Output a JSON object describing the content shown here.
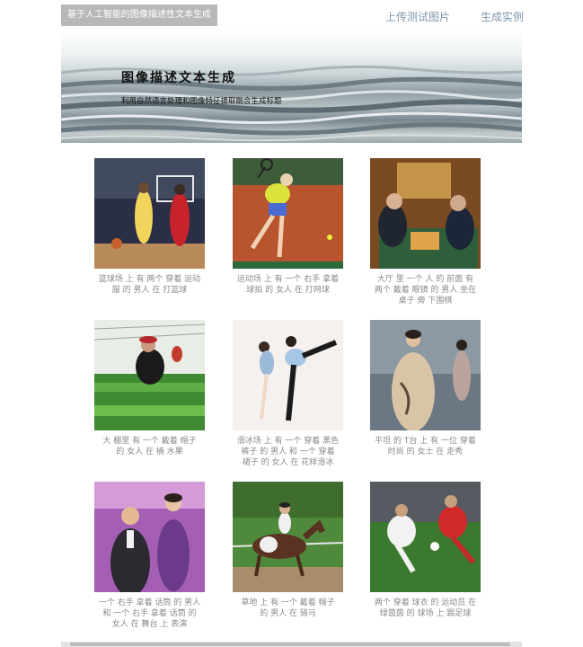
{
  "header": {
    "site_title": "基于人工智能的图像描述性文本生成",
    "nav": [
      "上传测试图片",
      "生成实例"
    ]
  },
  "banner": {
    "title": "图像描述文本生成",
    "subtitle": "利用自然语言处理和图像特征提取融合生成标题"
  },
  "gallery": [
    {
      "caption": "篮球场 上 有 两个 穿着 运动服 的 男人 在 打篮球"
    },
    {
      "caption": "运动场 上 有 一个 右手 拿着 球拍 的 女人 在 打网球"
    },
    {
      "caption": "大厅 里 一个 人 的 前面 有 两个 戴着 眼镜 的 男人 坐在 桌子 旁 下围棋"
    },
    {
      "caption": "大 棚里 有 一个 戴着 帽子 的 女人 在 摘 水果"
    },
    {
      "caption": "滑冰场 上 有 一个 穿着 黑色 裤子 的 男人 和 一个 穿着 裙子 的 女人 在 花样滑冰"
    },
    {
      "caption": "平坦 的 T台 上 有 一位 穿着 时尚 的 女士 在 走秀"
    },
    {
      "caption": "一个 右手 拿着 话筒 的 男人 和 一个 右手 拿着 话筒 的 女人 在 舞台 上 表演"
    },
    {
      "caption": "草地 上 有 一个 戴着 帽子 的 男人 在 骑马"
    },
    {
      "caption": "两个 穿着 球衣 的 运动员 在 绿茵茵 的 球场 上 踢足球"
    }
  ],
  "colors": {
    "nav_link": "#7e97ad",
    "title_bg": "#b8b8b8",
    "caption": "#8a8a8a"
  }
}
